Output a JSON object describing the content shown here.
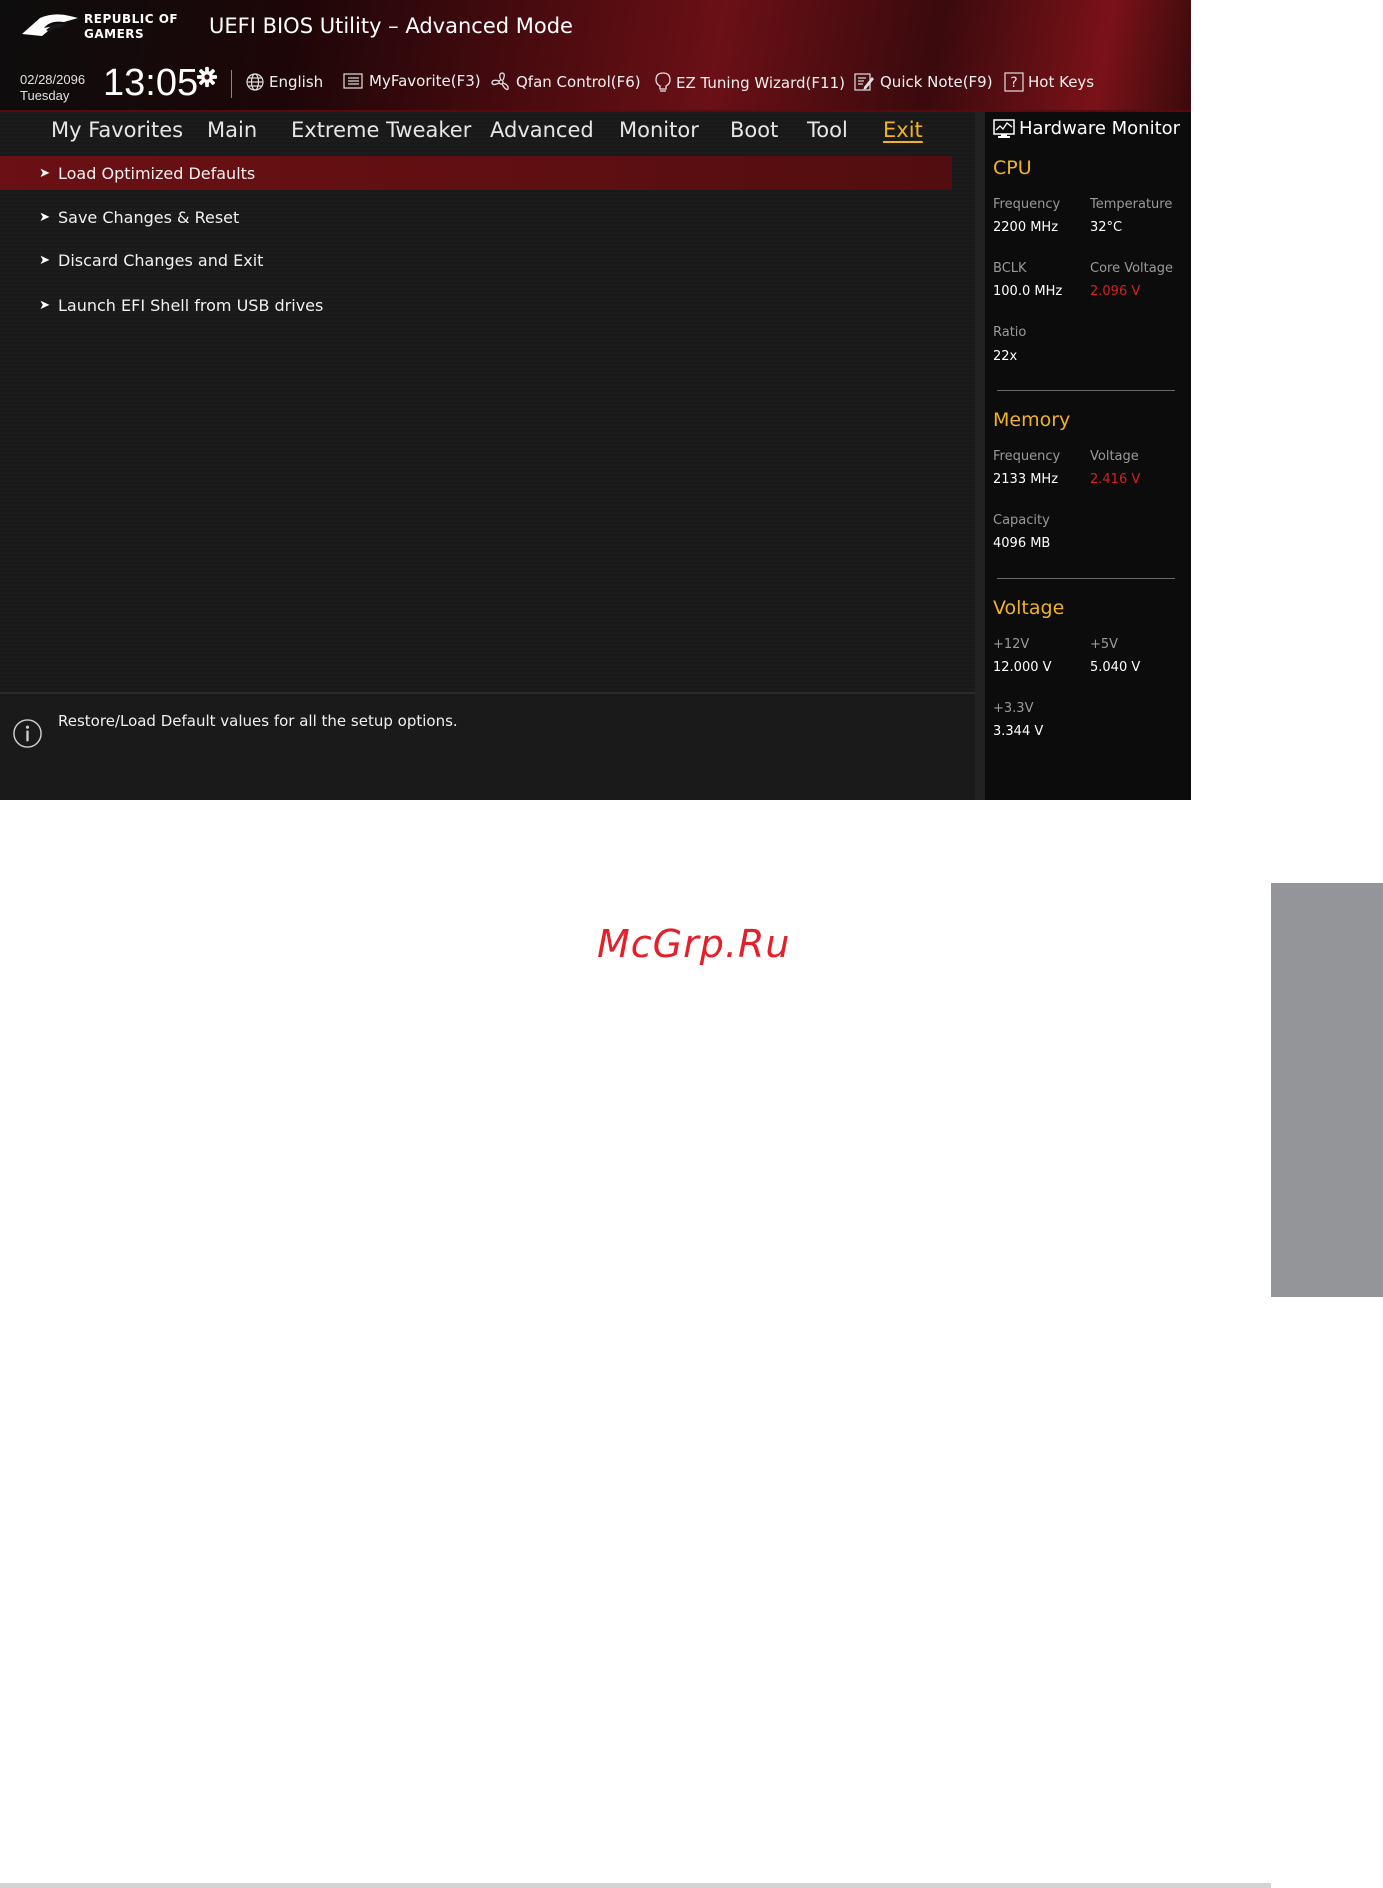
{
  "header": {
    "logo_line1": "REPUBLIC OF",
    "logo_line2": "GAMERS",
    "title": "UEFI BIOS Utility – Advanced Mode",
    "date": "02/28/2096",
    "weekday": "Tuesday",
    "time": "13:05"
  },
  "toolbar": {
    "language": "English",
    "myfavorite": "MyFavorite(F3)",
    "qfan": "Qfan Control(F6)",
    "ez_tuning": "EZ Tuning Wizard(F11)",
    "quick_note": "Quick Note(F9)",
    "hot_keys": "Hot Keys"
  },
  "tabs": [
    {
      "label": "My Favorites"
    },
    {
      "label": "Main"
    },
    {
      "label": "Extreme Tweaker"
    },
    {
      "label": "Advanced"
    },
    {
      "label": "Monitor"
    },
    {
      "label": "Boot"
    },
    {
      "label": "Tool"
    },
    {
      "label": "Exit",
      "active": true
    }
  ],
  "menu": [
    {
      "label": "Load Optimized Defaults",
      "selected": true
    },
    {
      "label": "Save Changes & Reset"
    },
    {
      "label": "Discard Changes and Exit"
    },
    {
      "label": "Launch EFI Shell from USB drives"
    }
  ],
  "help": {
    "text": "Restore/Load Default values for all the setup options."
  },
  "hardware_monitor": {
    "title": "Hardware Monitor",
    "cpu": {
      "heading": "CPU",
      "frequency_label": "Frequency",
      "frequency": "2200 MHz",
      "temperature_label": "Temperature",
      "temperature": "32°C",
      "bclk_label": "BCLK",
      "bclk": "100.0 MHz",
      "core_voltage_label": "Core Voltage",
      "core_voltage": "2.096 V",
      "ratio_label": "Ratio",
      "ratio": "22x"
    },
    "memory": {
      "heading": "Memory",
      "frequency_label": "Frequency",
      "frequency": "2133 MHz",
      "voltage_label": "Voltage",
      "voltage": "2.416 V",
      "capacity_label": "Capacity",
      "capacity": "4096 MB"
    },
    "voltage": {
      "heading": "Voltage",
      "v12_label": "+12V",
      "v12": "12.000 V",
      "v5_label": "+5V",
      "v5": "5.040 V",
      "v33_label": "+3.3V",
      "v33": "3.344 V"
    }
  },
  "colors": {
    "accent": "#f2b321",
    "selected_row": "#6b1014",
    "warning_value": "#d8201f",
    "side_tab": "#939598",
    "watermark": "#e4202a"
  },
  "watermark": "McGrp.Ru"
}
